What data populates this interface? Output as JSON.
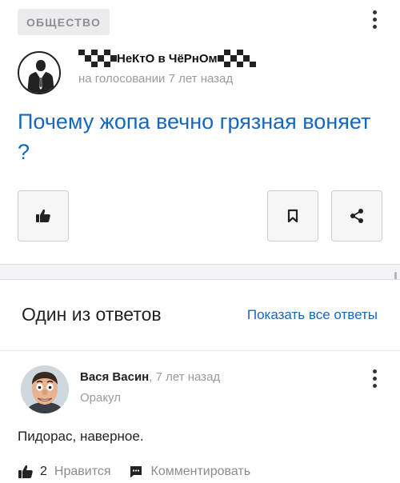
{
  "question": {
    "category": "ОБЩЕСТВО",
    "author": {
      "name": "НеКтО в ЧёРнОм",
      "meta": "на голосовании 7 лет назад"
    },
    "title": "Почему жопа вечно грязная воняет ?"
  },
  "answers": {
    "heading": "Один из ответов",
    "show_all": "Показать все ответы",
    "answer": {
      "author": "Вася Васин",
      "time": ", 7 лет назад",
      "role": "Оракул",
      "text": "Пидорас, наверное.",
      "likes": "2",
      "like_label": "Нравится",
      "comment_label": "Комментировать"
    }
  },
  "colors": {
    "link": "#1667c0",
    "muted": "#9a9aa0",
    "badge_bg": "#ececee"
  }
}
